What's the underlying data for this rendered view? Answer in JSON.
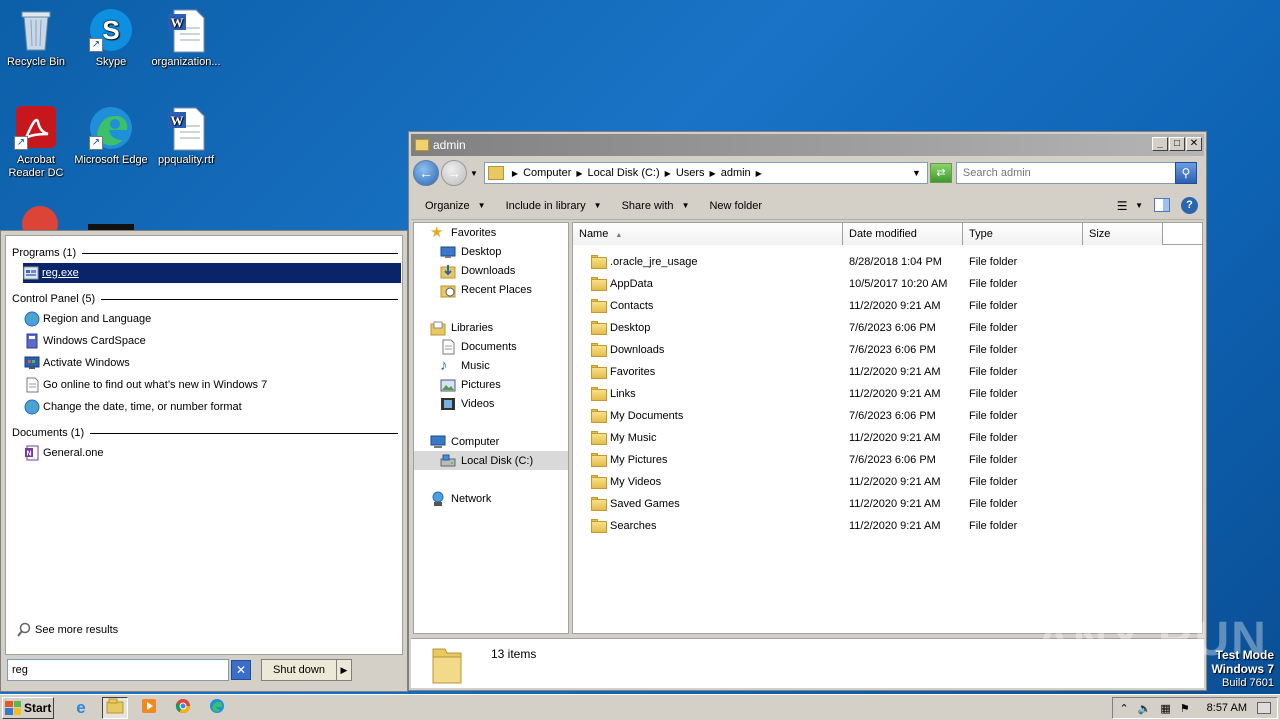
{
  "desktop": {
    "icons": [
      {
        "label": "Recycle Bin",
        "icon": "recycle-bin-icon"
      },
      {
        "label": "Skype",
        "icon": "skype-icon"
      },
      {
        "label": "organization...",
        "icon": "word-document-icon"
      },
      {
        "label": "Acrobat Reader DC",
        "icon": "acrobat-icon"
      },
      {
        "label": "Microsoft Edge",
        "icon": "edge-icon"
      },
      {
        "label": "ppquality.rtf",
        "icon": "word-document-icon"
      }
    ]
  },
  "start_menu": {
    "sections": [
      {
        "header": "Programs (1)",
        "items": [
          {
            "label": "reg.exe",
            "icon": "reg-exe-icon",
            "selected": true
          }
        ]
      },
      {
        "header": "Control Panel (5)",
        "items": [
          {
            "label": "Region and Language",
            "icon": "globe-icon"
          },
          {
            "label": "Windows CardSpace",
            "icon": "cardspace-icon"
          },
          {
            "label": "Activate Windows",
            "icon": "activate-windows-icon"
          },
          {
            "label": "Go online to find out what’s new in Windows 7",
            "icon": "document-icon"
          },
          {
            "label": "Change the date, time, or number format",
            "icon": "globe-icon"
          }
        ]
      },
      {
        "header": "Documents (1)",
        "items": [
          {
            "label": "General.one",
            "icon": "onenote-icon"
          }
        ]
      }
    ],
    "see_more": "See more results",
    "search_value": "reg",
    "shutdown_label": "Shut down"
  },
  "explorer": {
    "title": "admin",
    "breadcrumbs": [
      "Computer",
      "Local Disk (C:)",
      "Users",
      "admin"
    ],
    "search_placeholder": "Search admin",
    "toolbar": [
      "Organize",
      "Include in library",
      "Share with",
      "New folder"
    ],
    "nav_pane": {
      "favorites_header": "Favorites",
      "favorites": [
        "Desktop",
        "Downloads",
        "Recent Places"
      ],
      "libraries_header": "Libraries",
      "libraries": [
        "Documents",
        "Music",
        "Pictures",
        "Videos"
      ],
      "computer_header": "Computer",
      "computer_items": [
        "Local Disk (C:)"
      ],
      "network_header": "Network"
    },
    "columns": [
      "Name",
      "Date modified",
      "Type",
      "Size"
    ],
    "files": [
      {
        "name": ".oracle_jre_usage",
        "date": "8/28/2018 1:04 PM",
        "type": "File folder"
      },
      {
        "name": "AppData",
        "date": "10/5/2017 10:20 AM",
        "type": "File folder"
      },
      {
        "name": "Contacts",
        "date": "11/2/2020 9:21 AM",
        "type": "File folder"
      },
      {
        "name": "Desktop",
        "date": "7/6/2023 6:06 PM",
        "type": "File folder"
      },
      {
        "name": "Downloads",
        "date": "7/6/2023 6:06 PM",
        "type": "File folder"
      },
      {
        "name": "Favorites",
        "date": "11/2/2020 9:21 AM",
        "type": "File folder"
      },
      {
        "name": "Links",
        "date": "11/2/2020 9:21 AM",
        "type": "File folder"
      },
      {
        "name": "My Documents",
        "date": "7/6/2023 6:06 PM",
        "type": "File folder"
      },
      {
        "name": "My Music",
        "date": "11/2/2020 9:21 AM",
        "type": "File folder"
      },
      {
        "name": "My Pictures",
        "date": "7/6/2023 6:06 PM",
        "type": "File folder"
      },
      {
        "name": "My Videos",
        "date": "11/2/2020 9:21 AM",
        "type": "File folder"
      },
      {
        "name": "Saved Games",
        "date": "11/2/2020 9:21 AM",
        "type": "File folder"
      },
      {
        "name": "Searches",
        "date": "11/2/2020 9:21 AM",
        "type": "File folder"
      }
    ],
    "item_count": "13 items"
  },
  "watermark": "ANY RUN",
  "test_mode": {
    "line1": "Test Mode",
    "line2": "Windows 7",
    "line3": "Build 7601"
  },
  "taskbar": {
    "start_label": "Start",
    "clock": "8:57 AM",
    "apps": [
      "internet-explorer-icon",
      "explorer-icon",
      "media-player-icon",
      "chrome-icon",
      "edge-icon"
    ]
  }
}
